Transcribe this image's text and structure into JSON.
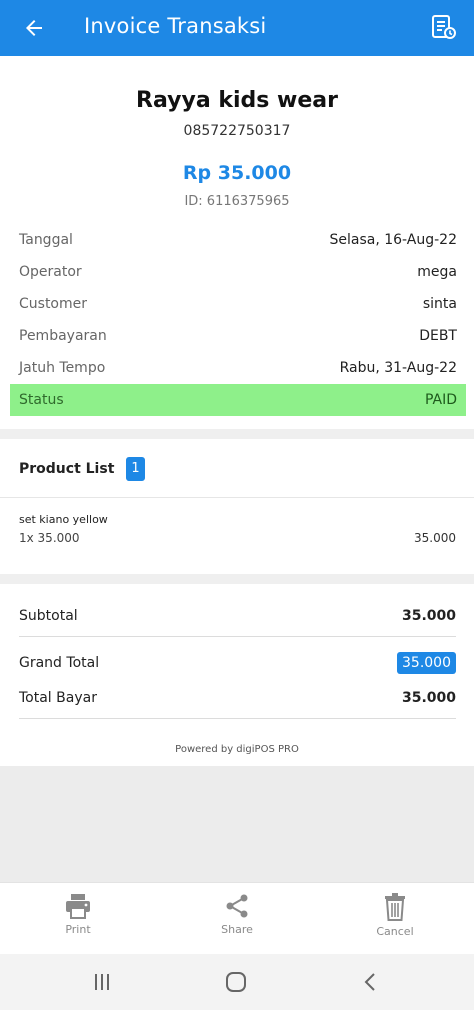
{
  "app_bar": {
    "title": "Invoice Transaksi",
    "back_icon": "arrow-left-icon",
    "receipt_icon": "receipt-icon"
  },
  "store": {
    "name": "Rayya kids wear",
    "phone": "085722750317",
    "amount": "Rp 35.000",
    "id_text": "ID: 6116375965"
  },
  "info": [
    {
      "label": "Tanggal",
      "value": "Selasa, 16-Aug-22"
    },
    {
      "label": "Operator",
      "value": "mega"
    },
    {
      "label": "Customer",
      "value": "sinta"
    },
    {
      "label": "Pembayaran",
      "value": "DEBT"
    },
    {
      "label": "Jatuh Tempo",
      "value": "Rabu, 31-Aug-22"
    },
    {
      "label": "Status",
      "value": "PAID"
    }
  ],
  "product_list": {
    "label": "Product List",
    "count": "1",
    "items": [
      {
        "name": "set kiano yellow",
        "qty_price": "1x 35.000",
        "total": "35.000"
      }
    ]
  },
  "totals": {
    "subtotal_label": "Subtotal",
    "subtotal_value": "35.000",
    "grand_total_label": "Grand Total",
    "grand_total_value": "35.000",
    "total_bayar_label": "Total Bayar",
    "total_bayar_value": "35.000"
  },
  "powered_by": "Powered by digiPOS PRO",
  "actions": {
    "print": "Print",
    "share": "Share",
    "cancel": "Cancel"
  },
  "colors": {
    "primary": "#1e88e5",
    "status_paid_bg": "#8ef08a"
  }
}
